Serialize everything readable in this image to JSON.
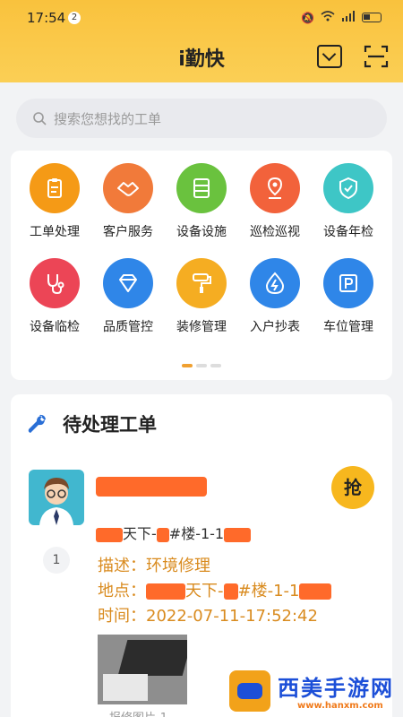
{
  "status_bar": {
    "time": "17:54",
    "notification_count": "2"
  },
  "header": {
    "title": "i勤快"
  },
  "search": {
    "placeholder": "搜索您想找的工单"
  },
  "quick_menu": [
    {
      "label": "工单处理",
      "icon": "clipboard-icon",
      "color": "#f59a16"
    },
    {
      "label": "客户服务",
      "icon": "handshake-icon",
      "color": "#f17a3a"
    },
    {
      "label": "设备设施",
      "icon": "server-icon",
      "color": "#6ac23e"
    },
    {
      "label": "巡检巡视",
      "icon": "location-pin-icon",
      "color": "#f2623b"
    },
    {
      "label": "设备年检",
      "icon": "shield-check-icon",
      "color": "#3ec6c6"
    },
    {
      "label": "设备临检",
      "icon": "stethoscope-icon",
      "color": "#ec4556"
    },
    {
      "label": "品质管控",
      "icon": "diamond-icon",
      "color": "#2f86e8"
    },
    {
      "label": "装修管理",
      "icon": "paint-roller-icon",
      "color": "#f5ad22"
    },
    {
      "label": "入户抄表",
      "icon": "water-drop-icon",
      "color": "#2f86e8"
    },
    {
      "label": "车位管理",
      "icon": "parking-icon",
      "color": "#2f86e8"
    }
  ],
  "pending": {
    "title": "待处理工单",
    "grab_label": "抢",
    "index": "1",
    "location_parts": [
      "天下-",
      "#楼-1-1"
    ],
    "description": "描述：环境修理",
    "address_parts": [
      "地点：",
      "天下-",
      "#楼-1-1"
    ],
    "time": "时间：2022-07-11-17:52:42",
    "photo_caption": "报修图片-1"
  },
  "watermark": {
    "text": "西美手游网",
    "url": "www.hanxm.com"
  }
}
